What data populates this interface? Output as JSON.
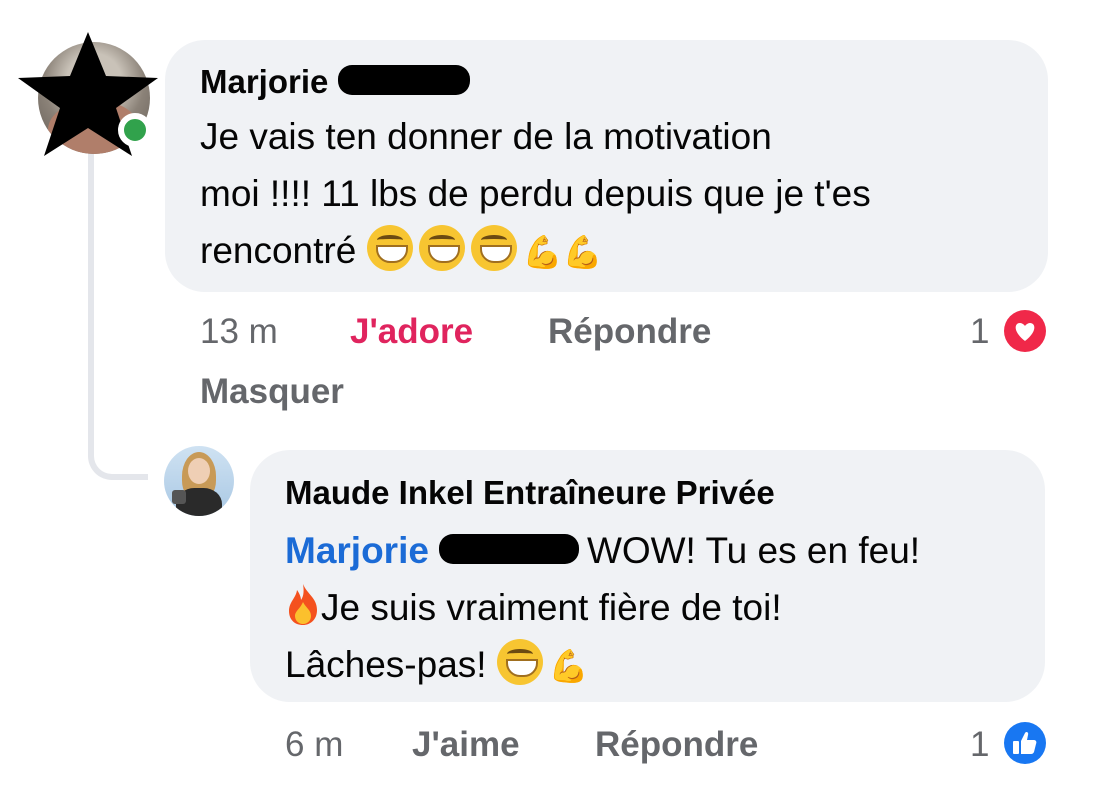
{
  "comment": {
    "author": "Marjorie",
    "text_line1": "Je vais ten donner de la motivation",
    "text_line2": "moi !!!! 11 lbs de perdu depuis que je t'es",
    "text_line3": "rencontré",
    "emoji_grin": "grinning-face",
    "emoji_muscle": "flexed-biceps",
    "time": "13 m",
    "reaction_label": "J'adore",
    "reply_label": "Répondre",
    "reaction_count": "1",
    "reaction_icon": "heart-icon",
    "hide_label": "Masquer"
  },
  "reply": {
    "author": "Maude Inkel Entraîneure Privée",
    "mention": "Marjorie",
    "text_line1": "WOW! Tu es en feu!",
    "text_line2": "Je suis vraiment fière de toi!",
    "text_line3": "Lâches-pas!",
    "emoji_fire": "fire",
    "time": "6 m",
    "like_label": "J'aime",
    "reply_label": "Répondre",
    "reaction_count": "1",
    "reaction_icon": "like-icon"
  },
  "colors": {
    "bubble": "#f0f2f5",
    "meta_gray": "#65676b",
    "love_red": "#e0245e",
    "mention_blue": "#1b6bd6",
    "online_green": "#31a24c"
  }
}
